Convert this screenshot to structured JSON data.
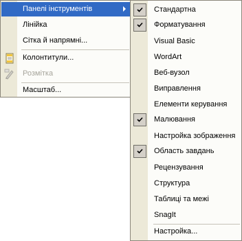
{
  "main_menu": {
    "items": [
      {
        "label": "Панелі інструментів",
        "submenu": true
      },
      {
        "label": "Лінійка"
      },
      {
        "label": "Сітка й напрямні..."
      },
      {
        "label": "Колонтитули..."
      },
      {
        "label": "Розмітка",
        "disabled": true
      },
      {
        "label": "Масштаб..."
      }
    ]
  },
  "toolbars_submenu": {
    "items": [
      {
        "label": "Стандартна",
        "checked": true
      },
      {
        "label": "Форматування",
        "checked": true
      },
      {
        "label": "Visual Basic",
        "checked": false
      },
      {
        "label": "WordArt",
        "checked": false
      },
      {
        "label": "Веб-вузол",
        "checked": false
      },
      {
        "label": "Виправлення",
        "checked": false
      },
      {
        "label": "Елементи керування",
        "checked": false
      },
      {
        "label": "Малювання",
        "checked": true
      },
      {
        "label": "Настройка зображення",
        "checked": false
      },
      {
        "label": "Область завдань",
        "checked": true
      },
      {
        "label": "Рецензування",
        "checked": false
      },
      {
        "label": "Структура",
        "checked": false
      },
      {
        "label": "Таблиці та межі",
        "checked": false
      },
      {
        "label": "SnagIt",
        "checked": false
      },
      {
        "label": "Настройка...",
        "checked": false
      }
    ]
  },
  "icons": {
    "submenu_arrow": "chevron-right-icon",
    "checkmark": "checkmark-icon",
    "header_footer": "header-footer-icon",
    "markup": "markup-icon"
  },
  "colors": {
    "highlight": "#316ac5",
    "menu_bg": "#fcfcf9",
    "gutter": "#ece9d8",
    "disabled_text": "#a7a59c"
  }
}
